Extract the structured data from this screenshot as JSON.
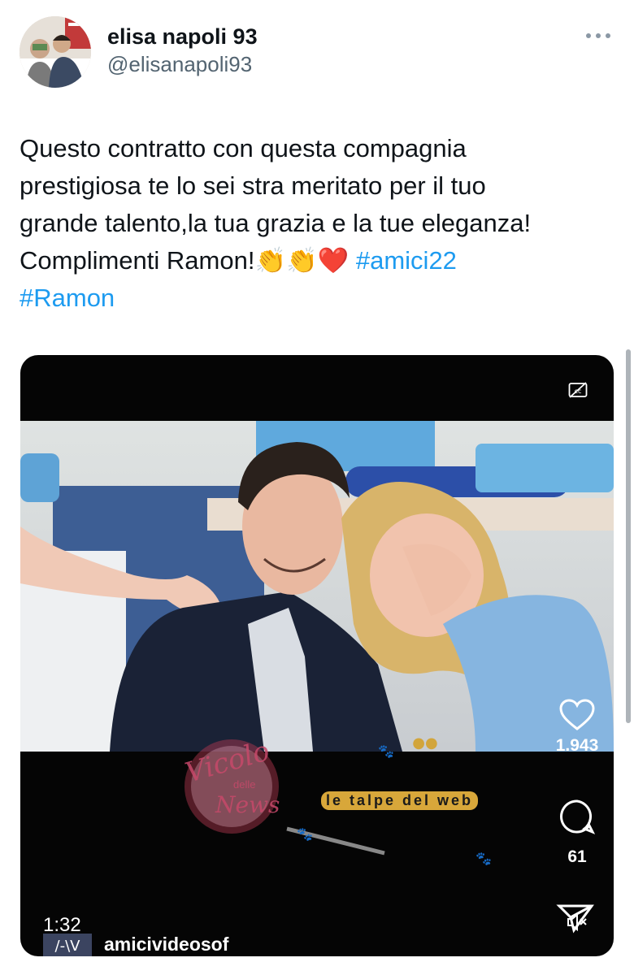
{
  "tweet": {
    "display_name": "elisa napoli 93",
    "handle": "@elisanapoli93",
    "text_lines": [
      "Questo contratto con questa compagnia",
      "prestigiosa te lo sei stra meritato per il tuo",
      "grande talento,la tua grazia e la tue eleganza!"
    ],
    "last_line_text": "Complimenti Ramon!",
    "emojis": "👏👏❤️",
    "hashtag_1": "#amici22",
    "hashtag_2": "#Ramon"
  },
  "video": {
    "likes": "1.943",
    "comments": "61",
    "duration": "1:32",
    "channel_name": "amicivideosof",
    "watermark_title": "Vicolo",
    "watermark_sub1": "delle",
    "watermark_sub2": "News",
    "watermark_right": "le talpe del web"
  },
  "colors": {
    "accent": "#1d9bf0",
    "text": "#0f1419",
    "secondary": "#536471",
    "media_bg": "#050505"
  },
  "icons": [
    "more-icon",
    "captions-icon",
    "heart-icon",
    "comment-icon",
    "share-icon",
    "mute-icon"
  ]
}
